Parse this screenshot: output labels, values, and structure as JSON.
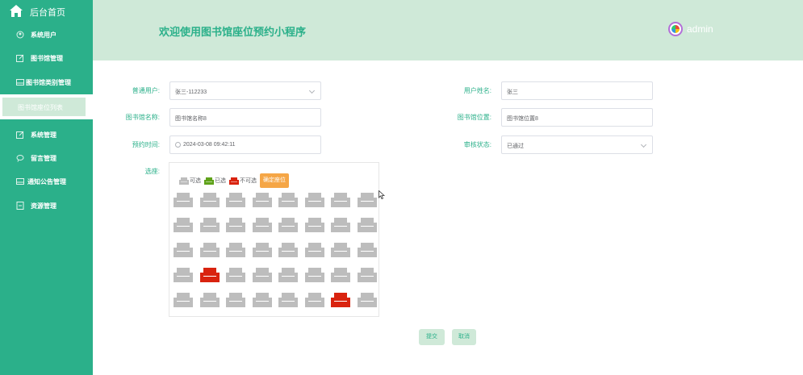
{
  "sidebar": {
    "home_label": "后台首页",
    "items": [
      {
        "label": "系统用户",
        "icon": "user-circle-icon"
      },
      {
        "label": "图书馆管理",
        "icon": "edit-icon"
      },
      {
        "label": "图书馆类别管理",
        "icon": "window-icon"
      },
      {
        "label": "图书馆座位列表",
        "icon": "none",
        "active": true
      },
      {
        "label": "系统管理",
        "icon": "edit-icon"
      },
      {
        "label": "留言管理",
        "icon": "chat-icon"
      },
      {
        "label": "通知公告管理",
        "icon": "window-icon"
      },
      {
        "label": "资源管理",
        "icon": "file-icon"
      }
    ],
    "colors": {
      "bg": "#2bb08a",
      "active_bg": "#cfe9d8"
    }
  },
  "header": {
    "title": "欢迎使用图书馆座位预约小程序",
    "username": "admin",
    "bg": "#cfe9d8"
  },
  "form": {
    "user": {
      "label": "普通用户:",
      "value": "张三-112233"
    },
    "user_name": {
      "label": "用户姓名:",
      "value": "张三"
    },
    "library_name": {
      "label": "图书馆名称:",
      "value": "图书馆名称8"
    },
    "library_location": {
      "label": "图书馆位置:",
      "value": "图书馆位置8"
    },
    "reserve_time": {
      "label": "预约时间:",
      "value": "2024-03-08 09:42:11"
    },
    "audit_status": {
      "label": "审核状态:",
      "value": "已通过"
    },
    "seat_label": "选座:"
  },
  "seat_picker": {
    "legend": {
      "available": "可选",
      "selected": "已选",
      "unavailable": "不可选",
      "confirm_button": "确定座位"
    },
    "rows": 5,
    "cols": 8,
    "unavailable_seats": [
      [
        3,
        1
      ],
      [
        4,
        6
      ]
    ],
    "colors": {
      "available": "#bdbdbd",
      "selected": "#5fa21a",
      "unavailable": "#d9230f",
      "confirm_bg": "#f5a646"
    }
  },
  "actions": {
    "submit": "提交",
    "cancel": "取消"
  }
}
